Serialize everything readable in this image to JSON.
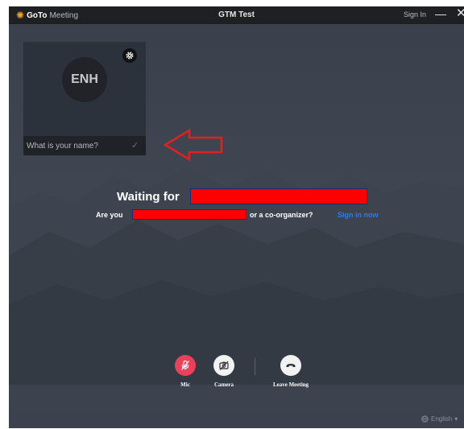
{
  "titlebar": {
    "brand_part1": "GoTo",
    "brand_part2": "Meeting",
    "window_title": "GTM Test",
    "signin_label": "Sign In",
    "minimize_glyph": "—",
    "close_glyph": "✕"
  },
  "preview": {
    "avatar_initials": "ENH",
    "name_placeholder": "What is your name?",
    "name_value": ""
  },
  "main": {
    "waiting_label": "Waiting for",
    "are_you_label": "Are you",
    "coorganizer_label": "or a co-organizer?",
    "signin_now_label": "Sign in now"
  },
  "controls": {
    "mic_label": "Mic",
    "camera_label": "Camera",
    "leave_label": "Leave Meeting"
  },
  "footer": {
    "language_label": "English"
  },
  "colors": {
    "background": "#3f4652",
    "titlebar": "#1e2024",
    "mic_active": "#e9415a",
    "link": "#2e7be6",
    "annotation_arrow": "#e32020",
    "redaction": "#ff0000",
    "brand_accent": "#f5a623"
  },
  "icons": [
    "gotomeeting-logo",
    "gear-icon",
    "check-icon",
    "mic-off-icon",
    "camera-off-icon",
    "leave-meeting-icon",
    "globe-icon",
    "chevron-down-icon"
  ]
}
